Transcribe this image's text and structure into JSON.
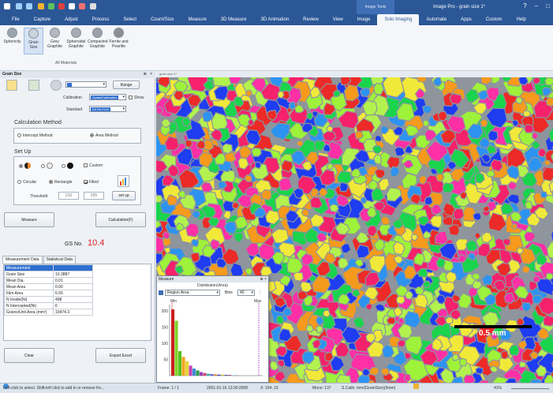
{
  "app": {
    "window_title": "Image Pro - grain size 1*",
    "image_tools_label": "Image Tools"
  },
  "ribbon": {
    "tabs": [
      "File",
      "Capture",
      "Adjust",
      "Process",
      "Select",
      "Count/Size",
      "Measure",
      "3D Measure",
      "3D Animation",
      "Review",
      "View",
      "Image",
      "Solo Imaging",
      "Automate",
      "Apps",
      "Custom",
      "Help"
    ],
    "active_tab": "Solo Imaging",
    "buttons": [
      {
        "label": "Sphericity",
        "icon": "sphericity-icon"
      },
      {
        "label": "Grain Size",
        "icon": "grain-size-icon"
      },
      {
        "label": "Grey Graphite",
        "icon": "grey-graphite-icon"
      },
      {
        "label": "Spheroidal Graphite",
        "icon": "spheroidal-graphite-icon"
      },
      {
        "label": "Compacted Graphite",
        "icon": "compacted-graphite-icon"
      },
      {
        "label": "Ferrite and Pearlite",
        "icon": "ferrite-pearlite-icon"
      }
    ],
    "selected_button": "Grain Size",
    "group_label": "All Materials"
  },
  "panel": {
    "title": "Grain Size",
    "range_button": "Range",
    "calibration_label": "Calibration",
    "calibration_value": "SpatialCalibration",
    "show_label": "Show",
    "standard_label": "Standard",
    "standard_value": "ASTM E112",
    "calc_method_title": "Calculation Method",
    "intercept_label": "Intercept Method",
    "area_label": "Area Method",
    "setup_title": "Set Up",
    "custom_label": "Custom",
    "circular_label": "Circular",
    "rectangle_label": "Rectangle",
    "filled_label": "Filled",
    "threshold_label": "Threshold",
    "threshold_low": "210",
    "threshold_high": "255",
    "setup_button": "set up",
    "measure_button": "Measure",
    "calculation_button": "Calculation(F)",
    "gs_label": "GS No.",
    "gs_value": "10.4",
    "tabs": [
      "Measurement Data",
      "Statistical Data"
    ],
    "table": [
      [
        "Measurement",
        ""
      ],
      [
        "Grain Size",
        "10.3887"
      ],
      [
        "Mean Dia.",
        "0.01"
      ],
      [
        "Mean Area",
        "0.00"
      ],
      [
        "Film Area",
        "6.65"
      ],
      [
        "N Inside(Ni)",
        "498"
      ],
      [
        "N Intercepted(Ni)",
        "6"
      ],
      [
        "Grains/Unit Area (mm²)",
        "10474.3"
      ]
    ],
    "clear_button": "Clear",
    "export_button": "Export Excel"
  },
  "image": {
    "tab_label": "grain size 1*",
    "scale_label": "0.5 mm"
  },
  "histogram": {
    "window_title": "Measure",
    "subtitle": "Distribution(Area)",
    "feature_value": "Region Area",
    "bins_label": "Bins",
    "bins_value": "40",
    "min_label": "Min",
    "max_label": "Max",
    "y_ticks": [
      "200",
      "150",
      "100",
      "50"
    ]
  },
  "chart_data": {
    "type": "bar",
    "title": "Distribution(Area)",
    "xlabel": "Region Area",
    "ylabel": "",
    "ylim": [
      0,
      220
    ],
    "categories": [
      "1",
      "2",
      "3",
      "4",
      "5",
      "6",
      "7",
      "8",
      "9",
      "10",
      "11",
      "12",
      "13",
      "14",
      "15",
      "16",
      "17",
      "18",
      "19"
    ],
    "values": [
      205,
      170,
      76,
      58,
      45,
      31,
      22,
      16,
      11,
      8,
      6,
      5,
      4,
      3,
      3,
      2,
      2,
      1,
      1
    ],
    "colors": [
      "#cc1f1f",
      "#7fd42a",
      "#55c11e",
      "#f2a51d",
      "#e8d23a",
      "#c43fb2",
      "#3f8cd9",
      "#2d9a4a",
      "#9c3fb8",
      "#d23d73",
      "#3ab5a4",
      "#6b5bd6",
      "#e8832a",
      "#3b3fc1",
      "#c2c23a",
      "#2d2d8c",
      "#a11f64",
      "#35a0d6",
      "#777777"
    ],
    "grid": false
  },
  "status": {
    "hint": "Left-click to select. Shift-left click to add to or remove fro...",
    "frame": "Frame: 1 / 1",
    "datetime": "2001-01-16 13:30:2008",
    "coords": "X: 164, 15",
    "mono": "Mono: 137",
    "calib": "S.Calib: mm/(GrainSize)(5mm)",
    "zoom": "41%"
  }
}
